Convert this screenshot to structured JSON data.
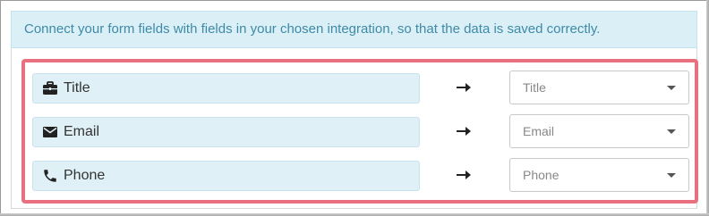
{
  "notice": {
    "text": "Connect your form fields with fields in your chosen integration, so that the data is saved correctly."
  },
  "colors": {
    "notice_bg": "#dbeff6",
    "notice_text": "#3e8aa8",
    "highlight_border": "#e8707f",
    "field_bg": "#dff0f7"
  },
  "mappings": [
    {
      "field_label": "Title",
      "field_icon": "briefcase-icon",
      "target_value": "Title"
    },
    {
      "field_label": "Email",
      "field_icon": "envelope-icon",
      "target_value": "Email"
    },
    {
      "field_label": "Phone",
      "field_icon": "phone-icon",
      "target_value": "Phone"
    }
  ]
}
